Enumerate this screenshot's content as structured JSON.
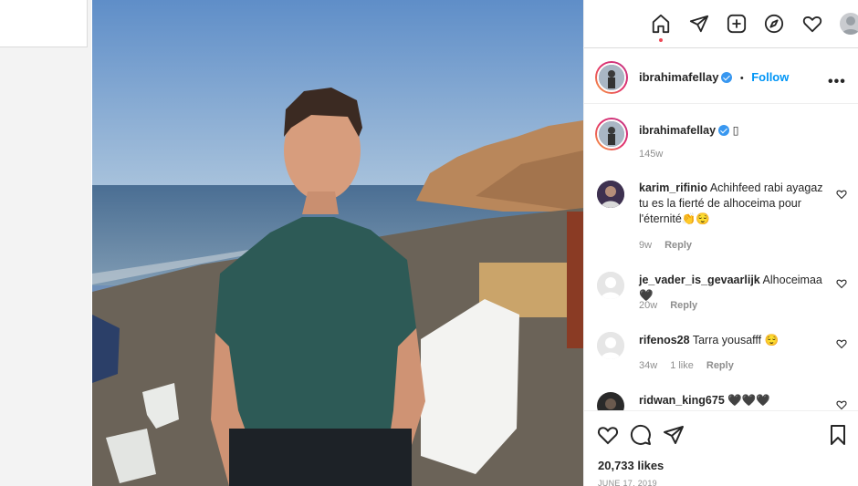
{
  "nav": {
    "icons": [
      "home-icon",
      "direct-icon",
      "new-post-icon",
      "explore-icon",
      "activity-icon",
      "profile-avatar"
    ]
  },
  "post": {
    "author": "ibrahimafellay",
    "follow_label": "Follow",
    "separator": "•",
    "more_label": "•••",
    "caption_text": "▯",
    "caption_time": "145w",
    "likes": "20,733 likes",
    "date": "JUNE 17, 2019"
  },
  "comments": [
    {
      "user": "karim_rifinio",
      "text": "Achihfeed rabi ayagaz tu es la fierté de alhoceima pour l'éternité👏😌",
      "time": "9w",
      "likes": "",
      "reply": "Reply"
    },
    {
      "user": "je_vader_is_gevaarlijk",
      "text": "Alhoceimaa🖤",
      "time": "20w",
      "likes": "",
      "reply": "Reply"
    },
    {
      "user": "rifenos28",
      "text": "Tarra yousafff 😌",
      "time": "34w",
      "likes": "1 like",
      "reply": "Reply"
    },
    {
      "user": "ridwan_king675",
      "text": "🖤🖤🖤",
      "time": "",
      "likes": "",
      "reply": ""
    }
  ],
  "colors": {
    "accent": "#0095f6",
    "verified": "#3897f0",
    "notification_dot": "#ed4956"
  }
}
